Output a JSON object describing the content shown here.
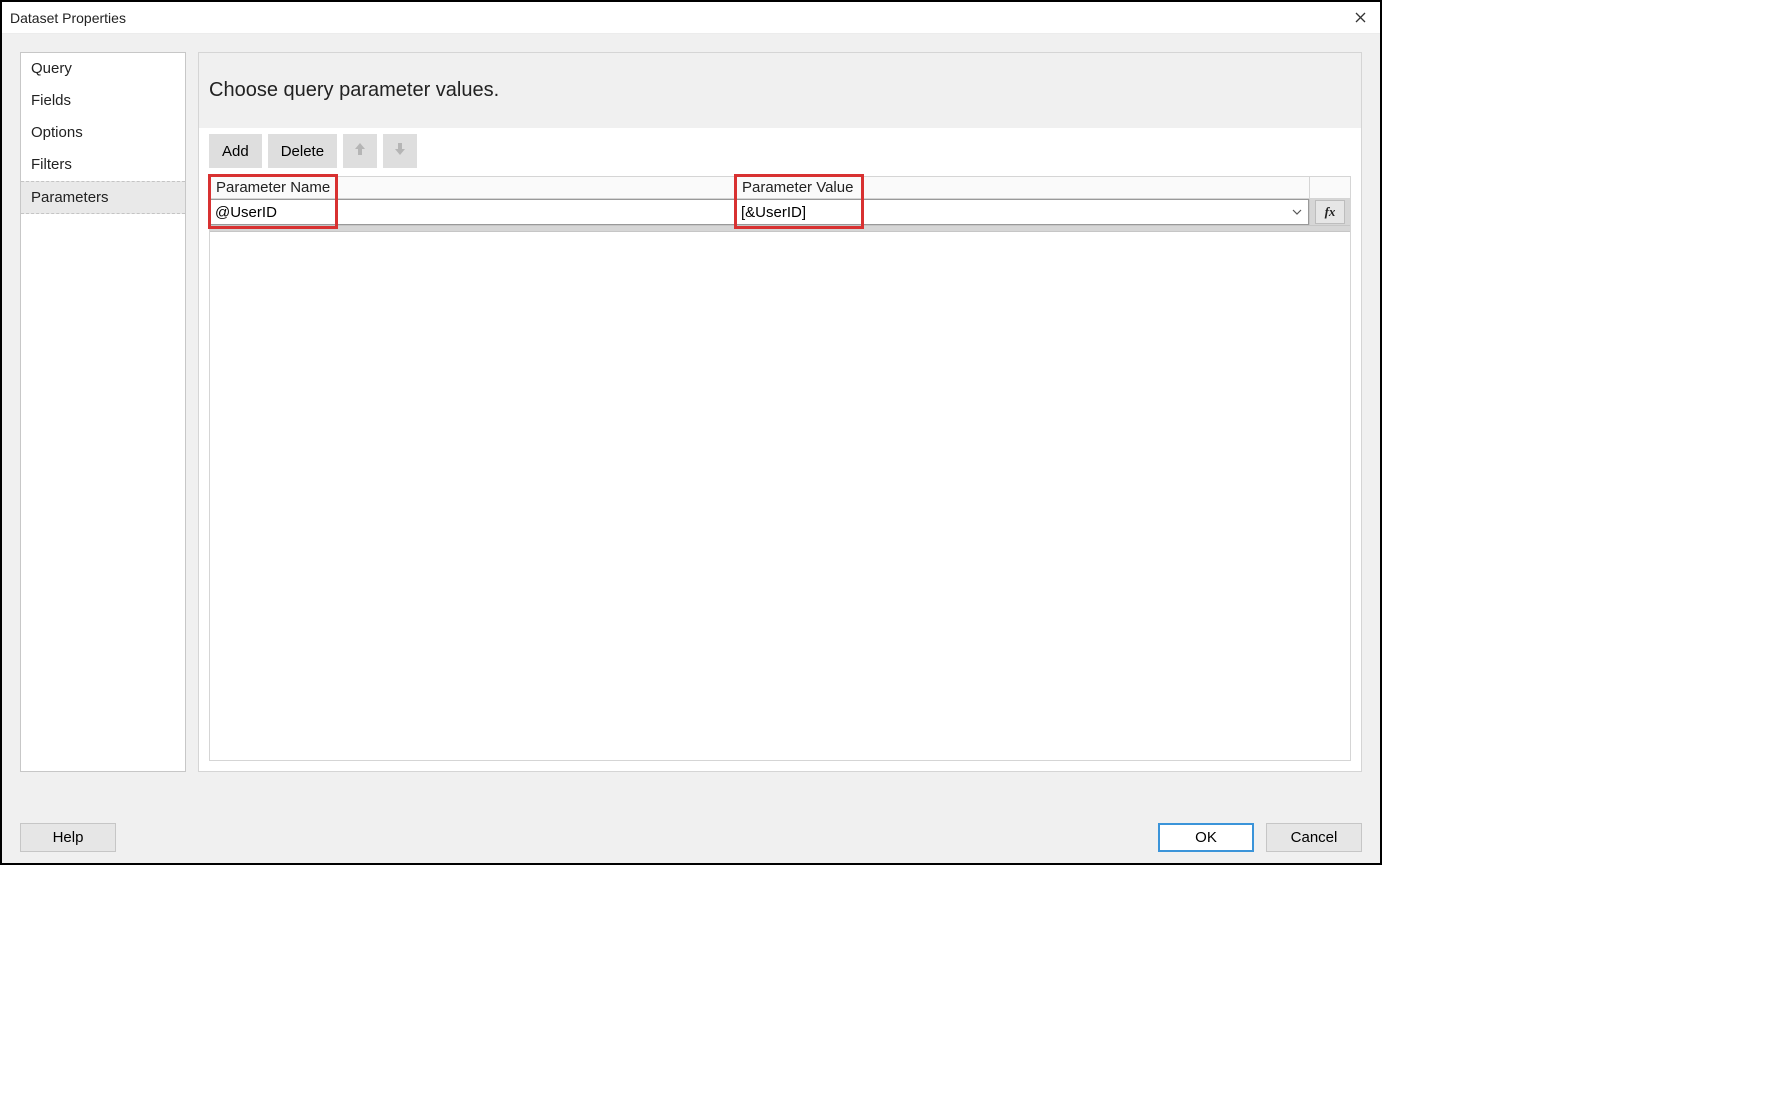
{
  "window": {
    "title": "Dataset Properties"
  },
  "sidebar": {
    "items": [
      {
        "label": "Query",
        "selected": false
      },
      {
        "label": "Fields",
        "selected": false
      },
      {
        "label": "Options",
        "selected": false
      },
      {
        "label": "Filters",
        "selected": false
      },
      {
        "label": "Parameters",
        "selected": true
      }
    ]
  },
  "main": {
    "heading": "Choose query parameter values.",
    "toolbar": {
      "add_label": "Add",
      "delete_label": "Delete",
      "move_up_icon": "move-up",
      "move_down_icon": "move-down"
    },
    "grid": {
      "columns": {
        "name_header": "Parameter Name",
        "value_header": "Parameter Value"
      },
      "rows": [
        {
          "name": "@UserID",
          "value": "[&UserID]"
        }
      ],
      "fx_label": "fx"
    }
  },
  "buttons": {
    "help": "Help",
    "ok": "OK",
    "cancel": "Cancel"
  }
}
